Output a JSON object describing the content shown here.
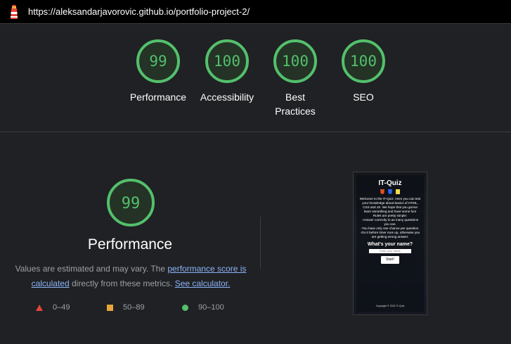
{
  "topbar": {
    "url": "https://aleksandarjavorovic.github.io/portfolio-project-2/",
    "icon": "lighthouse-icon"
  },
  "gauges": [
    {
      "score": "99",
      "label": "Performance"
    },
    {
      "score": "100",
      "label": "Accessibility"
    },
    {
      "score": "100",
      "label": "Best Practices"
    },
    {
      "score": "100",
      "label": "SEO"
    }
  ],
  "performance": {
    "score": "99",
    "title": "Performance",
    "desc_prefix": "Values are estimated and may vary. The ",
    "link_score": "performance score is calculated",
    "desc_middle": " directly from these metrics. ",
    "link_calc": "See calculator."
  },
  "legend": [
    {
      "icon": "red-triangle-icon",
      "range": "0–49",
      "color": "#e5453b"
    },
    {
      "icon": "orange-square-icon",
      "range": "50–89",
      "color": "#e6a63a"
    },
    {
      "icon": "green-circle-icon",
      "range": "90–100",
      "color": "#53c06c"
    }
  ],
  "thumbnail": {
    "title": "IT-Quiz",
    "intro": "Welcome to the IT-Quiz. Here you can test your knowledge about basics of HTML, CSS and JS. We hope that you gonna learn something and have some fun!",
    "rules_heading": "Rules are pretty simple:",
    "rule1": "-Answer correctly to as many questions you can.",
    "rule2": "-You have only one chance per question.",
    "rule3": "-Do it before timer runs up, otherwise you are getting wrong answer.",
    "question": "What's your name?",
    "input_placeholder": "Enter your name",
    "start_label": "Start!",
    "footer": "Copyright © 2022 IT-Quiz"
  },
  "colors": {
    "good": "#53c06c",
    "average": "#e6a63a",
    "poor": "#e5453b",
    "link": "#8ab4f8",
    "background": "#202124"
  }
}
